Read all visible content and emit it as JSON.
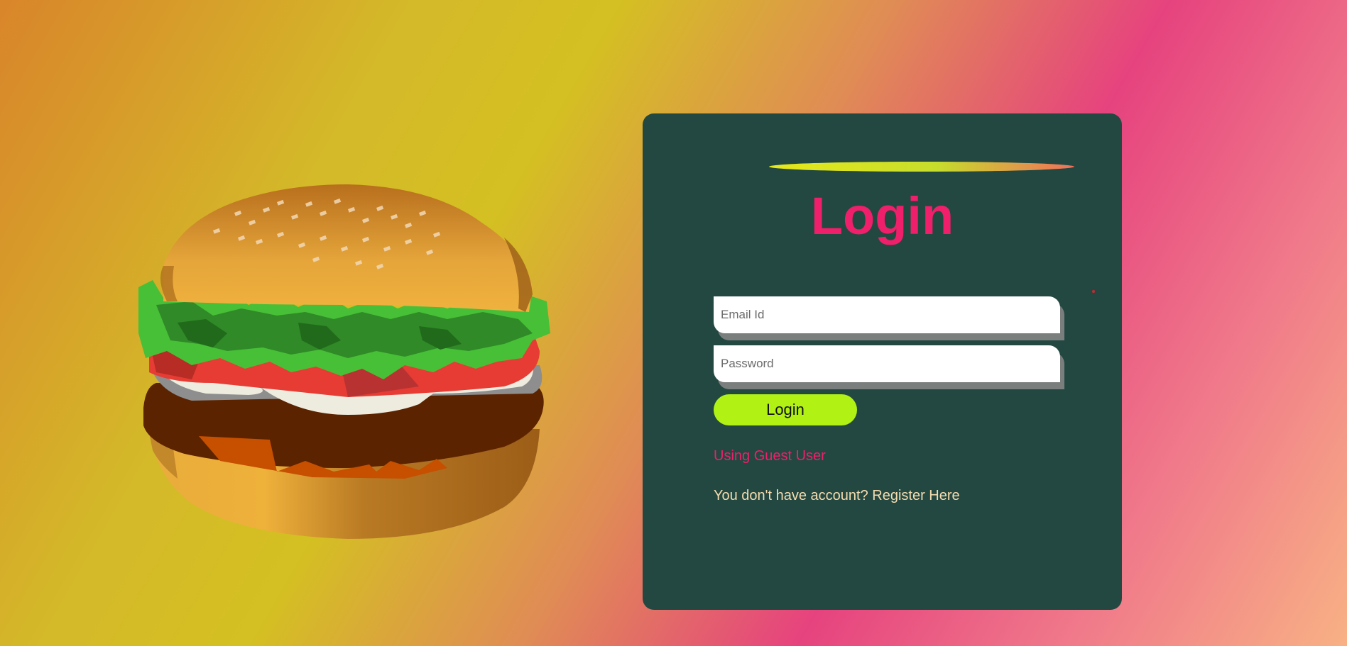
{
  "login_card": {
    "title": "Login",
    "email_placeholder": "Email Id",
    "password_placeholder": "Password",
    "login_button_label": "Login",
    "guest_link": "Using Guest User",
    "register_prompt": "You don't have account?",
    "register_link": "Register Here"
  },
  "colors": {
    "card_background": "#234841",
    "title": "#ef1f6c",
    "login_button": "#b1f214",
    "guest_link": "#ef1f6c",
    "register_text": "#f5dcb0"
  },
  "icons": {
    "hero_illustration": "burger-illustration"
  }
}
